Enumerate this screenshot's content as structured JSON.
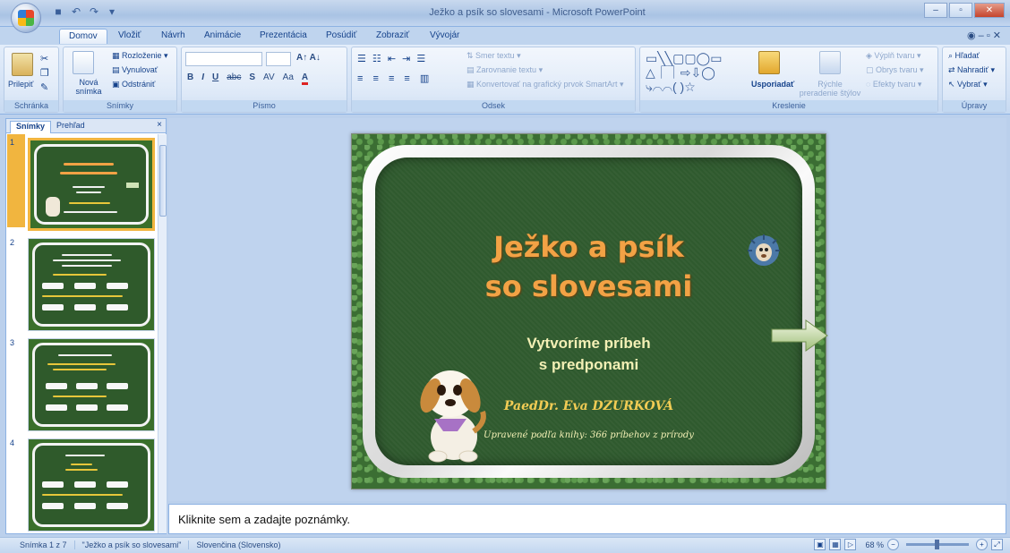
{
  "window": {
    "title": "Ježko a psík so slovesami - Microsoft PowerPoint",
    "controls": [
      "–",
      "▫",
      "✕"
    ]
  },
  "tabs": [
    "Domov",
    "Vložiť",
    "Návrh",
    "Animácie",
    "Prezentácia",
    "Posúdiť",
    "Zobraziť",
    "Vývojár"
  ],
  "ribbon": {
    "clipboard": {
      "label": "Schránka",
      "paste": "Prilepiť"
    },
    "slides": {
      "label": "Snímky",
      "new_slide": "Nová snímka",
      "layout": "Rozloženie",
      "reset": "Vynulovať",
      "delete": "Odstrániť"
    },
    "font": {
      "label": "Písmo",
      "buttons": [
        "B",
        "I",
        "U",
        "abc",
        "S",
        "AV",
        "Aa",
        "A"
      ]
    },
    "paragraph": {
      "label": "Odsek",
      "text_direction": "Smer textu",
      "align_text": "Zarovnanie textu",
      "convert": "Konvertovať na grafický prvok SmartArt"
    },
    "drawing": {
      "label": "Kreslenie",
      "arrange": "Usporiadať",
      "quick_styles": "Rýchle preradenie štýlov",
      "fill": "Výplň tvaru",
      "outline": "Obrys tvaru",
      "effects": "Efekty tvaru"
    },
    "editing": {
      "label": "Úpravy",
      "find": "Hľadať",
      "replace": "Nahradiť",
      "select": "Vybrať"
    }
  },
  "panel": {
    "tabs": [
      "Snímky",
      "Prehľad"
    ],
    "close": "×",
    "thumbs": [
      {
        "num": "1",
        "title": "Ježko a psík so slovesami"
      },
      {
        "num": "2"
      },
      {
        "num": "3"
      },
      {
        "num": "4"
      }
    ]
  },
  "slide": {
    "title_line1": "Ježko a psík",
    "title_line2": "so slovesami",
    "subtitle_line1": "Vytvoríme príbeh",
    "subtitle_line2": "s predponami",
    "author": "PaedDr. Eva DZURKOVÁ",
    "source": "Upravené podľa knihy:  366 príbehov z prírody"
  },
  "notes": {
    "placeholder": "Kliknite sem a zadajte poznámky."
  },
  "status": {
    "slide_count": "Snímka 1 z 7",
    "theme": "\"Ježko a psík so slovesami\"",
    "language": "Slovenčina (Slovensko)",
    "zoom": "68 %"
  },
  "colors": {
    "accent": "#f1b53f",
    "board": "#2f5a2e",
    "title": "#f2a245"
  }
}
